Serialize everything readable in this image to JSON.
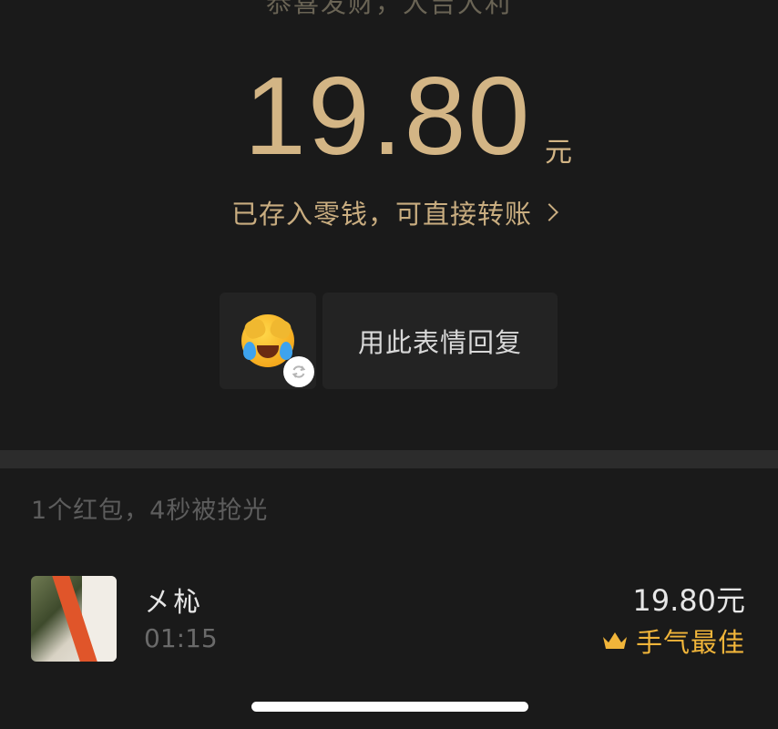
{
  "header": {
    "greeting": "恭喜发财，大吉大利"
  },
  "amount": {
    "value": "19.80",
    "unit": "元",
    "stored_text": "已存入零钱，可直接转账"
  },
  "emoji_reply": {
    "emoji_name": "crying-laughing-face-icon",
    "reply_label": "用此表情回复"
  },
  "summary": {
    "text": "1个红包，4秒被抢光"
  },
  "records": [
    {
      "name": "㐅杺",
      "time": "01:15",
      "amount": "19.80元",
      "badge": "手气最佳"
    }
  ],
  "colors": {
    "gold": "#d3b585",
    "best_badge": "#f1b53a",
    "background": "#1a1a1a"
  }
}
